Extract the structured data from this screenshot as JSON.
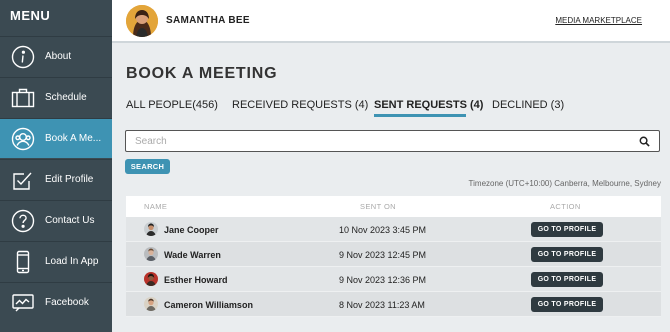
{
  "sidebar": {
    "title": "MENU",
    "items": [
      {
        "label": "About",
        "icon": "info-icon"
      },
      {
        "label": "Schedule",
        "icon": "briefcase-icon"
      },
      {
        "label": "Book A Me...",
        "icon": "users-icon"
      },
      {
        "label": "Edit Profile",
        "icon": "edit-icon"
      },
      {
        "label": "Contact Us",
        "icon": "question-icon"
      },
      {
        "label": "Load In App",
        "icon": "phone-icon"
      },
      {
        "label": "Facebook",
        "icon": "facebook-icon"
      }
    ],
    "active_label": "Book A Me..."
  },
  "header": {
    "user_name": "SAMANTHA BEE",
    "link": "MEDIA MARKETPLACE"
  },
  "main": {
    "title": "BOOK A MEETING",
    "tabs": [
      {
        "label": "ALL PEOPLE(456)"
      },
      {
        "label": "RECEIVED REQUESTS (4)"
      },
      {
        "label": "SENT REQUESTS (4)"
      },
      {
        "label": "DECLINED (3)"
      }
    ],
    "active_tab": "SENT REQUESTS (4)",
    "search": {
      "placeholder": "Search",
      "value": "",
      "button": "SEARCH"
    },
    "timezone": "Timezone (UTC+10:00) Canberra, Melbourne, Sydney",
    "table": {
      "columns": [
        "NAME",
        "SENT ON",
        "ACTION"
      ],
      "rows": [
        {
          "name": "Jane Cooper",
          "sent_on": "10 Nov 2023 3:45 PM",
          "action": "GO TO PROFILE"
        },
        {
          "name": "Wade Warren",
          "sent_on": "9 Nov 2023 12:45 PM",
          "action": "GO TO PROFILE"
        },
        {
          "name": "Esther Howard",
          "sent_on": "9 Nov 2023 12:36 PM",
          "action": "GO TO PROFILE"
        },
        {
          "name": "Cameron Williamson",
          "sent_on": "8 Nov 2023 11:23 AM",
          "action": "GO TO PROFILE"
        }
      ]
    }
  },
  "colors": {
    "sidebar_bg": "#3b4a52",
    "accent": "#3e93b3",
    "button_dark": "#2f3a40",
    "page_bg": "#eaedef"
  }
}
